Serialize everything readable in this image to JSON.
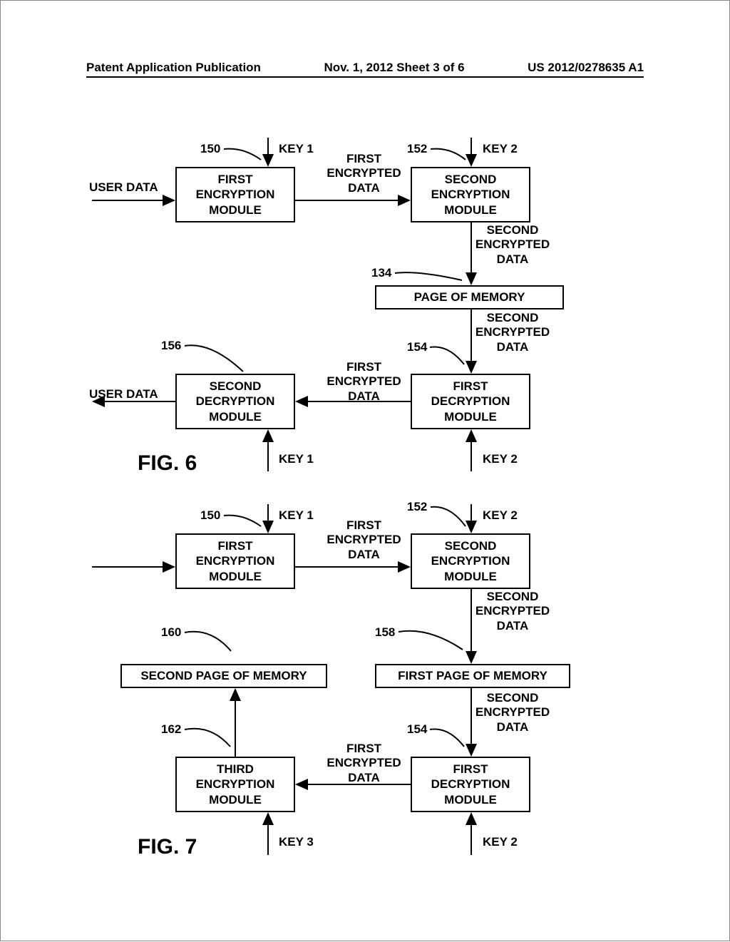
{
  "header": {
    "left": "Patent Application Publication",
    "center": "Nov. 1, 2012  Sheet 3 of 6",
    "right": "US 2012/0278635 A1"
  },
  "fig6": {
    "title": "FIG. 6",
    "user_data_in": "USER DATA",
    "user_data_out": "USER DATA",
    "key1": "KEY 1",
    "key2": "KEY 2",
    "ref150": "150",
    "ref152": "152",
    "ref134": "134",
    "ref154": "154",
    "ref156": "156",
    "fe_module": "FIRST\nENCRYPTION\nMODULE",
    "se_module": "SECOND\nENCRYPTION\nMODULE",
    "fd_module": "FIRST\nDECRYPTION\nMODULE",
    "sd_module": "SECOND\nDECRYPTION\nMODULE",
    "first_enc": "FIRST\nENCRYPTED\nDATA",
    "second_enc": "SECOND\nENCRYPTED\nDATA",
    "memory": "PAGE OF MEMORY"
  },
  "fig7": {
    "title": "FIG. 7",
    "key1": "KEY 1",
    "key2": "KEY 2",
    "key3": "KEY 3",
    "ref150": "150",
    "ref152": "152",
    "ref154": "154",
    "ref158": "158",
    "ref160": "160",
    "ref162": "162",
    "fe_module": "FIRST\nENCRYPTION\nMODULE",
    "se_module": "SECOND\nENCRYPTION\nMODULE",
    "te_module": "THIRD\nENCRYPTION\nMODULE",
    "fd_module": "FIRST\nDECRYPTION\nMODULE",
    "first_enc": "FIRST\nENCRYPTED\nDATA",
    "second_enc": "SECOND\nENCRYPTED\nDATA",
    "mem1": "FIRST PAGE OF MEMORY",
    "mem2": "SECOND PAGE OF MEMORY"
  }
}
